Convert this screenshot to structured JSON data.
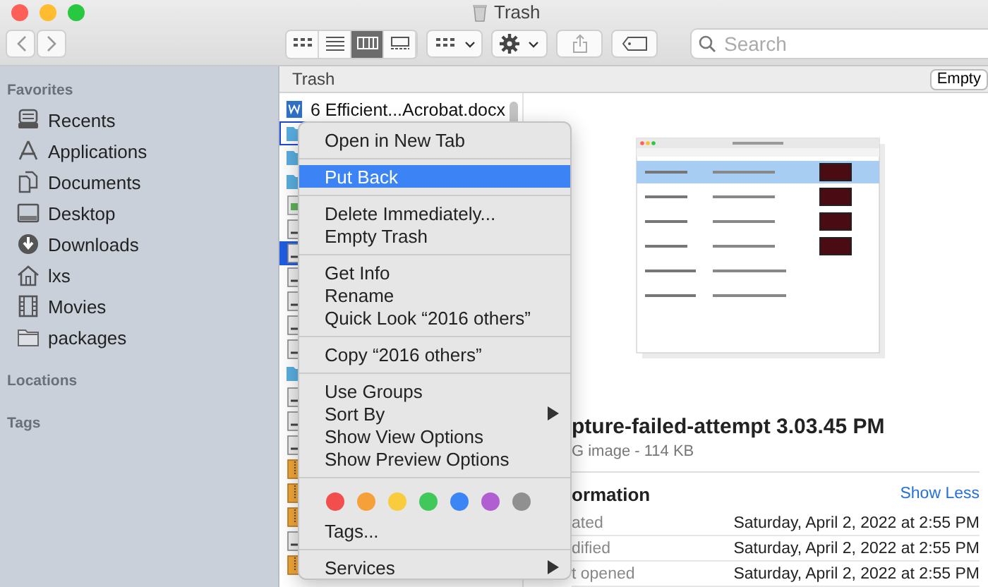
{
  "window": {
    "title": "Trash"
  },
  "toolbar": {
    "view_modes": [
      {
        "kind": "icons",
        "selected": false
      },
      {
        "kind": "list",
        "selected": false
      },
      {
        "kind": "columns",
        "selected": true
      },
      {
        "kind": "gallery",
        "selected": false
      }
    ],
    "search": {
      "placeholder": "Search"
    }
  },
  "sidebar": {
    "sections": [
      {
        "title": "Favorites",
        "items": [
          {
            "label": "Recents",
            "kind": "recents"
          },
          {
            "label": "Applications",
            "kind": "applications"
          },
          {
            "label": "Documents",
            "kind": "documents"
          },
          {
            "label": "Desktop",
            "kind": "desktop"
          },
          {
            "label": "Downloads",
            "kind": "downloads"
          },
          {
            "label": "lxs",
            "kind": "home"
          },
          {
            "label": "Movies",
            "kind": "movies"
          },
          {
            "label": "packages",
            "kind": "folder"
          }
        ]
      },
      {
        "title": "Locations"
      },
      {
        "title": "Tags"
      }
    ]
  },
  "path_bar": {
    "title": "Trash",
    "button": "Empty"
  },
  "files": [
    {
      "name": "6 Efficient...Acrobat.docx",
      "kind": "docx",
      "selected": false,
      "focused": false
    },
    {
      "kind": "folder",
      "selected": false,
      "focused": true
    },
    {
      "kind": "folder",
      "selected": false,
      "focused": false
    },
    {
      "kind": "folder",
      "selected": false,
      "focused": false
    },
    {
      "kind": "image",
      "selected": false,
      "focused": false
    },
    {
      "kind": "document",
      "selected": false,
      "focused": false
    },
    {
      "kind": "document",
      "selected": true,
      "focused": false
    },
    {
      "kind": "document",
      "selected": false,
      "focused": false
    },
    {
      "kind": "document",
      "selected": false,
      "focused": false
    },
    {
      "kind": "document",
      "selected": false,
      "focused": false
    },
    {
      "kind": "document",
      "selected": false,
      "focused": false
    },
    {
      "kind": "folder",
      "selected": false,
      "focused": false
    },
    {
      "kind": "document",
      "selected": false,
      "focused": false
    },
    {
      "kind": "document",
      "selected": false,
      "focused": false
    },
    {
      "kind": "document",
      "selected": false,
      "focused": false
    },
    {
      "kind": "archive",
      "selected": false,
      "focused": false
    },
    {
      "kind": "archive",
      "selected": false,
      "focused": false
    },
    {
      "kind": "archive",
      "selected": false,
      "focused": false
    },
    {
      "kind": "document",
      "selected": false,
      "focused": false
    },
    {
      "kind": "archive",
      "selected": false,
      "focused": false
    }
  ],
  "preview": {
    "file_name": "pture-failed-attempt 3.03.45 PM",
    "file_info": "G image - 114 KB",
    "section_title": "ormation",
    "toggle": "Show Less",
    "details": [
      {
        "label": "ated",
        "value": "Saturday, April 2, 2022 at 2:55 PM"
      },
      {
        "label": "dified",
        "value": "Saturday, April 2, 2022 at 2:55 PM"
      },
      {
        "label": "t opened",
        "value": "Saturday, April 2, 2022 at 2:55 PM"
      }
    ]
  },
  "context_menu": {
    "items": [
      {
        "kind": "item",
        "label": "Open in New Tab",
        "selected": false
      },
      {
        "kind": "separator"
      },
      {
        "kind": "item",
        "label": "Put Back",
        "selected": true
      },
      {
        "kind": "separator"
      },
      {
        "kind": "item",
        "label": "Delete Immediately...",
        "selected": false
      },
      {
        "kind": "item",
        "label": "Empty Trash",
        "selected": false
      },
      {
        "kind": "separator"
      },
      {
        "kind": "item",
        "label": "Get Info",
        "selected": false
      },
      {
        "kind": "item",
        "label": "Rename",
        "selected": false
      },
      {
        "kind": "item",
        "label": "Quick Look “2016 others”",
        "selected": false
      },
      {
        "kind": "separator"
      },
      {
        "kind": "item",
        "label": "Copy “2016 others”",
        "selected": false
      },
      {
        "kind": "separator"
      },
      {
        "kind": "item",
        "label": "Use Groups",
        "selected": false
      },
      {
        "kind": "submenu",
        "label": "Sort By",
        "selected": false
      },
      {
        "kind": "item",
        "label": "Show View Options",
        "selected": false
      },
      {
        "kind": "item",
        "label": "Show Preview Options",
        "selected": false
      },
      {
        "kind": "separator"
      },
      {
        "kind": "tags",
        "colors": [
          {
            "color": "#f24e4e"
          },
          {
            "color": "#f6a03a"
          },
          {
            "color": "#f8cc3c"
          },
          {
            "color": "#40c85a"
          },
          {
            "color": "#3b85f5"
          },
          {
            "color": "#b05ed2"
          },
          {
            "color": "#909090"
          }
        ]
      },
      {
        "kind": "item",
        "label": "Tags...",
        "selected": false
      },
      {
        "kind": "separator"
      },
      {
        "kind": "submenu",
        "label": "Services",
        "selected": false
      }
    ]
  }
}
